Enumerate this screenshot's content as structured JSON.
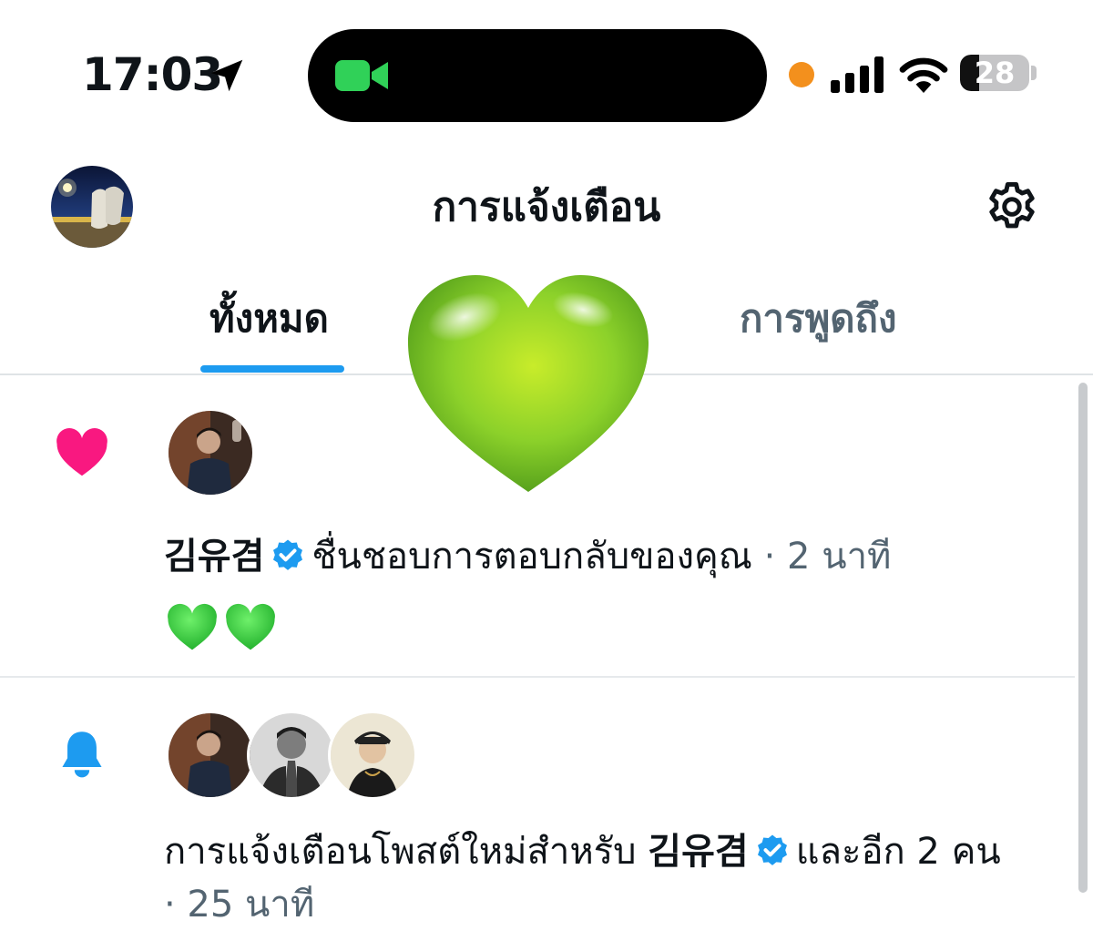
{
  "status_bar": {
    "time": "17:03",
    "battery": "28",
    "battery_level": 0.28,
    "recording_dot_color": "#f3901d",
    "facetime_color": "#30d158"
  },
  "header": {
    "title": "การแจ้งเตือน",
    "profile_icon": "profile-avatar",
    "settings_icon": "gear-icon"
  },
  "tabs": [
    {
      "label": "ทั้งหมด",
      "active": true
    },
    {
      "label": "การพูดถึง",
      "active": false
    }
  ],
  "accent_color": "#1d9bf0",
  "notifications": [
    {
      "icon": "heart-icon",
      "icon_color": "#f91880",
      "name": "김유겸",
      "verified": true,
      "action": "ชื่นชอบการตอบกลับของคุณ",
      "time": "· 2 นาที",
      "reply_preview": "💚💚"
    },
    {
      "icon": "bell-icon",
      "icon_color": "#1d9bf0",
      "prefix": "การแจ้งเตือนโพสต์ใหม่สำหรับ",
      "name": "김유겸",
      "verified": true,
      "suffix": "และอีก 2 คน",
      "time": "· 25 นาที"
    }
  ]
}
